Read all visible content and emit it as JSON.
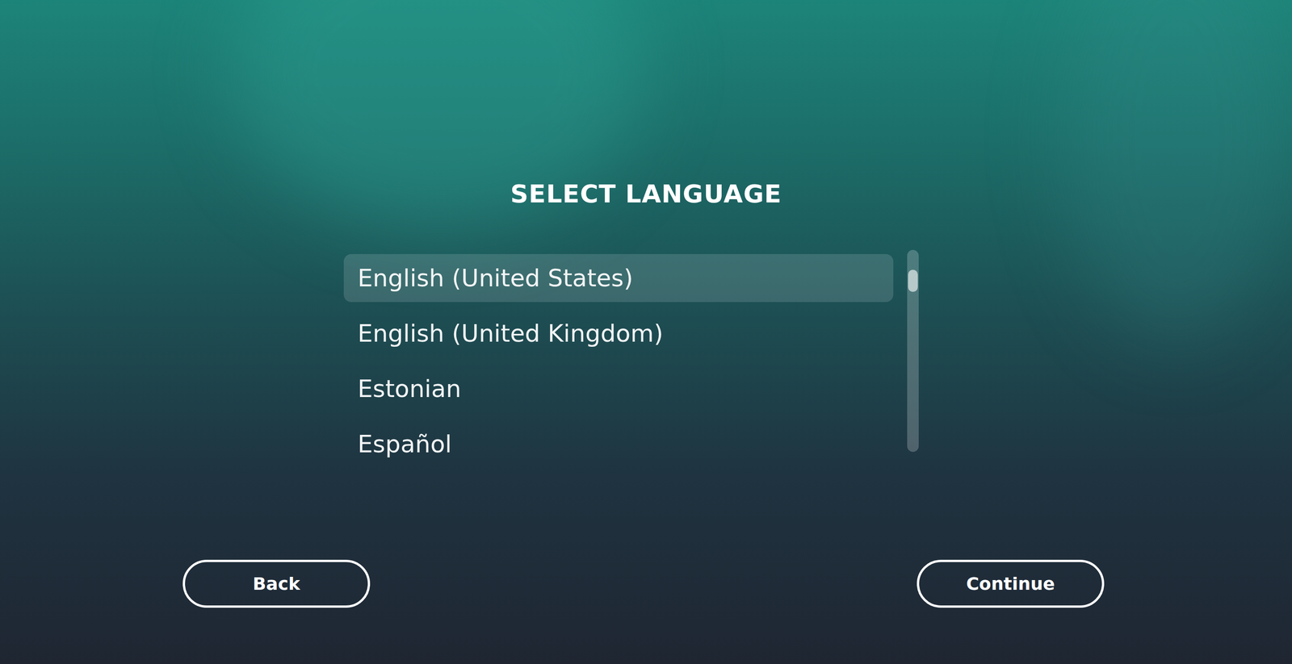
{
  "screen": {
    "title": "SELECT LANGUAGE"
  },
  "languages": [
    {
      "label": "English (United States)",
      "selected": true
    },
    {
      "label": "English (United Kingdom)",
      "selected": false
    },
    {
      "label": "Estonian",
      "selected": false
    },
    {
      "label": "Español",
      "selected": false
    }
  ],
  "scrollbar": {
    "position": 0.1,
    "thumb": 0.11
  },
  "buttons": [
    {
      "label": "Back"
    },
    {
      "label": "Continue"
    }
  ]
}
